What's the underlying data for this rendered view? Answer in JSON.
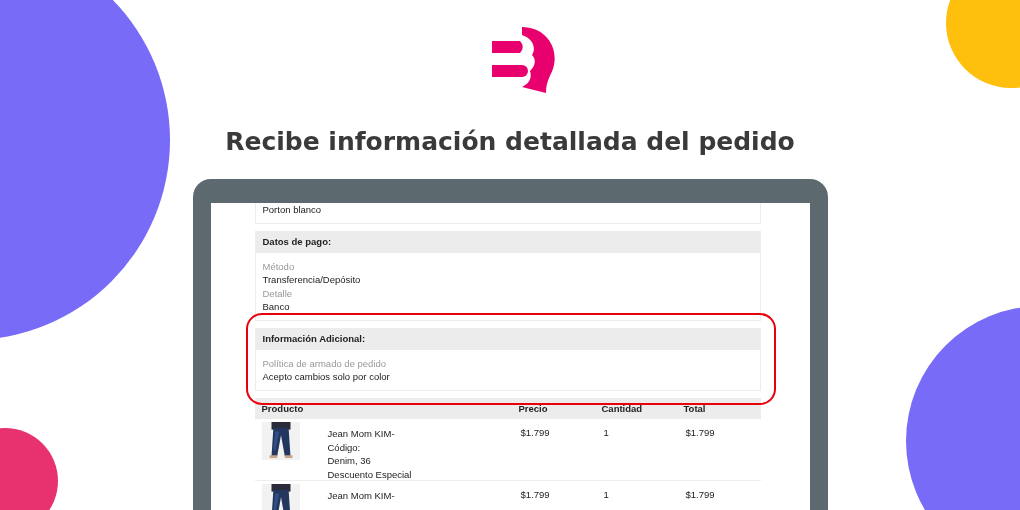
{
  "heading": "Recibe información detallada del pedido",
  "order": {
    "address_tail": "Porton blanco",
    "sections": [
      {
        "title": "Datos de pago:",
        "highlighted": false,
        "fields": [
          {
            "label": "Método",
            "value": "Transferencia/Depósito"
          },
          {
            "label": "Detalle",
            "value": "Banco"
          }
        ]
      },
      {
        "title": "Información Adicional:",
        "highlighted": true,
        "fields": [
          {
            "label": "Política de armado de pedido",
            "value": "Acepto cambios solo por color"
          }
        ]
      }
    ],
    "table": {
      "columns": [
        "Producto",
        "Precio",
        "Cantidad",
        "Total"
      ],
      "rows": [
        {
          "lines": [
            "Jean Mom KIM-",
            "Código:",
            "Denim, 36",
            "Descuento Especial"
          ],
          "price": "$1.799",
          "quantity": "1",
          "total": "$1.799"
        },
        {
          "lines": [
            "Jean Mom KIM-"
          ],
          "price": "$1.799",
          "quantity": "1",
          "total": "$1.799"
        }
      ]
    }
  }
}
